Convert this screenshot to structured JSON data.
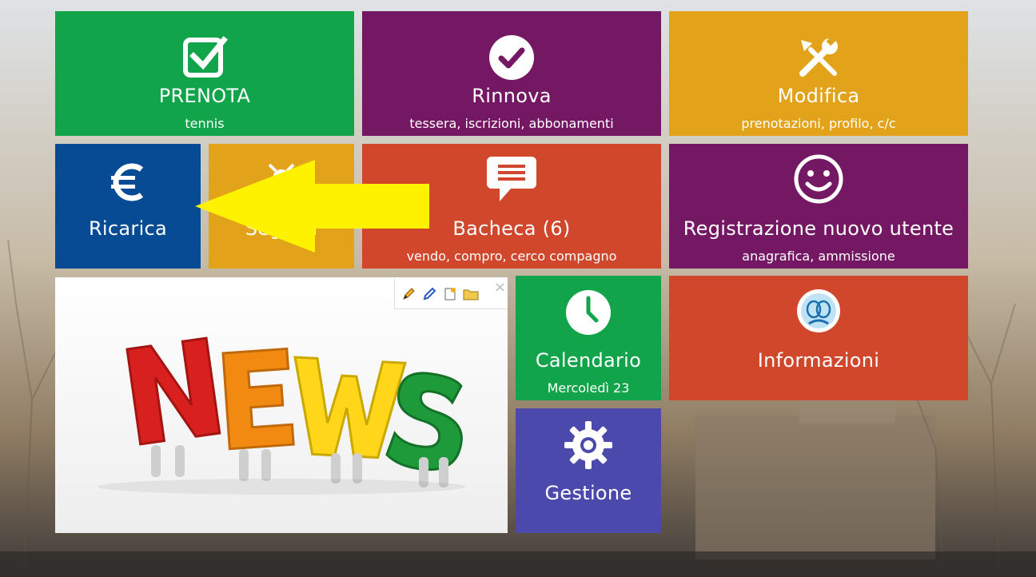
{
  "tiles": {
    "prenota": {
      "title": "PRENOTA",
      "sub": "tennis",
      "icon": "checkbox-icon"
    },
    "rinnova": {
      "title": "Rinnova",
      "sub": "tessera, iscrizioni, abbonamenti",
      "icon": "check-circle-icon"
    },
    "modifica": {
      "title": "Modifica",
      "sub": "prenotazioni, profilo, c/c",
      "icon": "tools-icon"
    },
    "ricarica": {
      "title": "Ricarica",
      "icon": "euro-icon"
    },
    "segnali": {
      "title": "Segnali",
      "icon": "bug-icon"
    },
    "bacheca": {
      "title": "Bacheca (6)",
      "sub": "vendo, compro, cerco compagno",
      "icon": "chat-bubble-icon"
    },
    "registrazione": {
      "title": "Registrazione nuovo utente",
      "sub": "anagrafica, ammissione",
      "icon": "smiley-icon"
    },
    "calendario": {
      "title": "Calendario",
      "sub": "Mercoledì 23",
      "icon": "clock-icon"
    },
    "informazioni": {
      "title": "Informazioni",
      "icon": "tennis-club-logo"
    },
    "gestione": {
      "title": "Gestione",
      "icon": "gear-icon"
    }
  },
  "news": {
    "image_label": "NEWS",
    "toolbar": [
      "pencil-icon",
      "edit-icon",
      "new-page-icon",
      "folder-icon"
    ],
    "close_label": "×"
  },
  "colors": {
    "green": "#11a44a",
    "purple": "#751864",
    "orange": "#e2a31a",
    "blue": "#064b93",
    "red": "#d0472b",
    "violet": "#4c49ad",
    "arrow": "#fff200"
  }
}
